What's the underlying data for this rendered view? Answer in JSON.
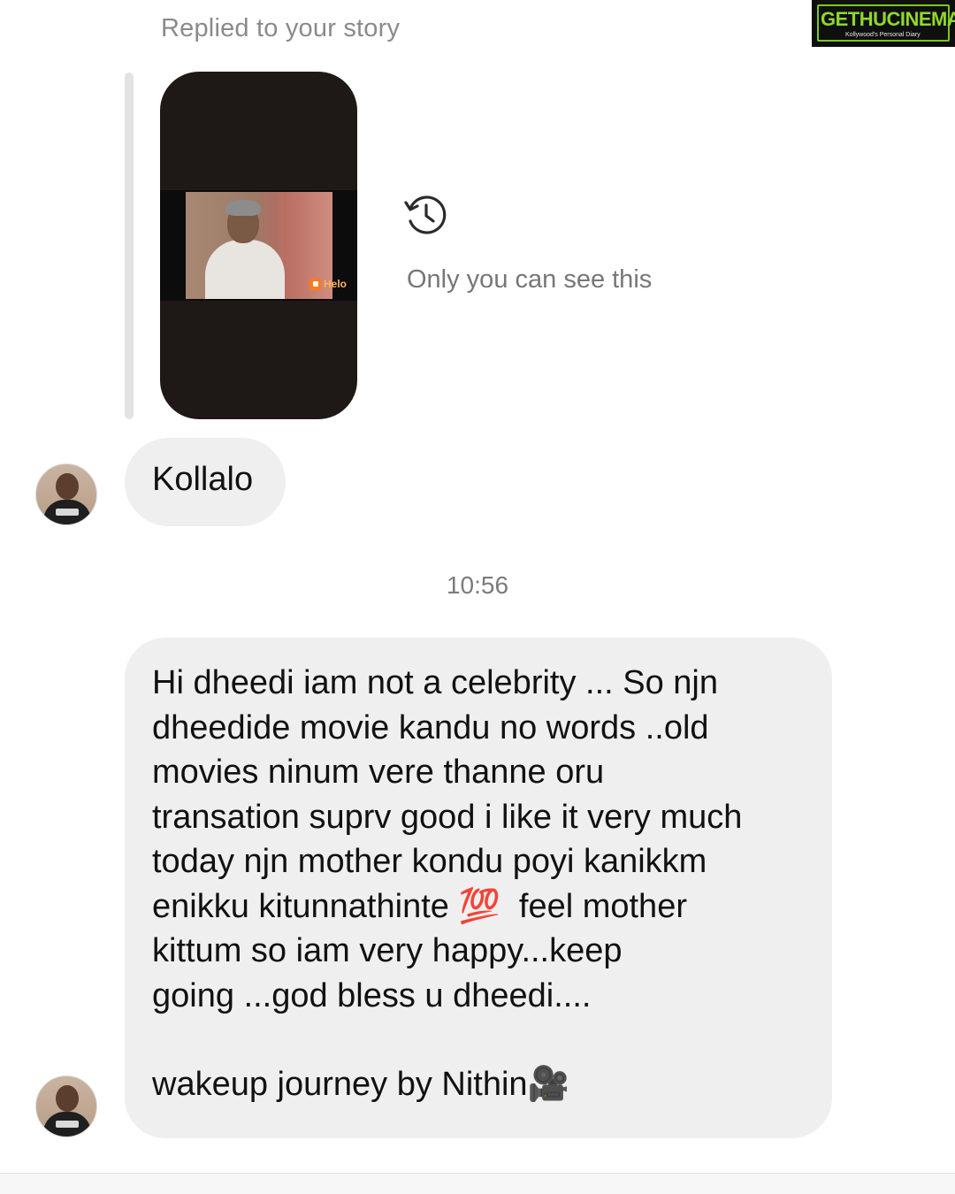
{
  "story_reply": {
    "label": "Replied to your story",
    "private_note": "Only you can see this",
    "watermark_logo": "Helo",
    "icon": "history-icon"
  },
  "messages": [
    {
      "text": "Kollalo"
    }
  ],
  "timestamp": "10:56",
  "long_message": {
    "text": "Hi dheedi iam not a celebrity ... So njn\ndheedide movie kandu no words ..old\nmovies ninum vere thanne oru\ntransation suprv good i like it very much\ntoday njn mother kondu poyi kanikkm\nenikku kitunnathinte 💯  feel mother\nkittum so iam very happy...keep\ngoing ...god bless u dheedi....",
    "signature": "wakeup journey by Nithin🎥"
  },
  "watermark": {
    "brand": "GETHUCINEMA",
    "tagline": "Kollywood's Personal Diary"
  },
  "colors": {
    "bubble_bg": "#efefef",
    "muted_text": "#8a8a8a",
    "watermark_green": "#8fd829"
  }
}
